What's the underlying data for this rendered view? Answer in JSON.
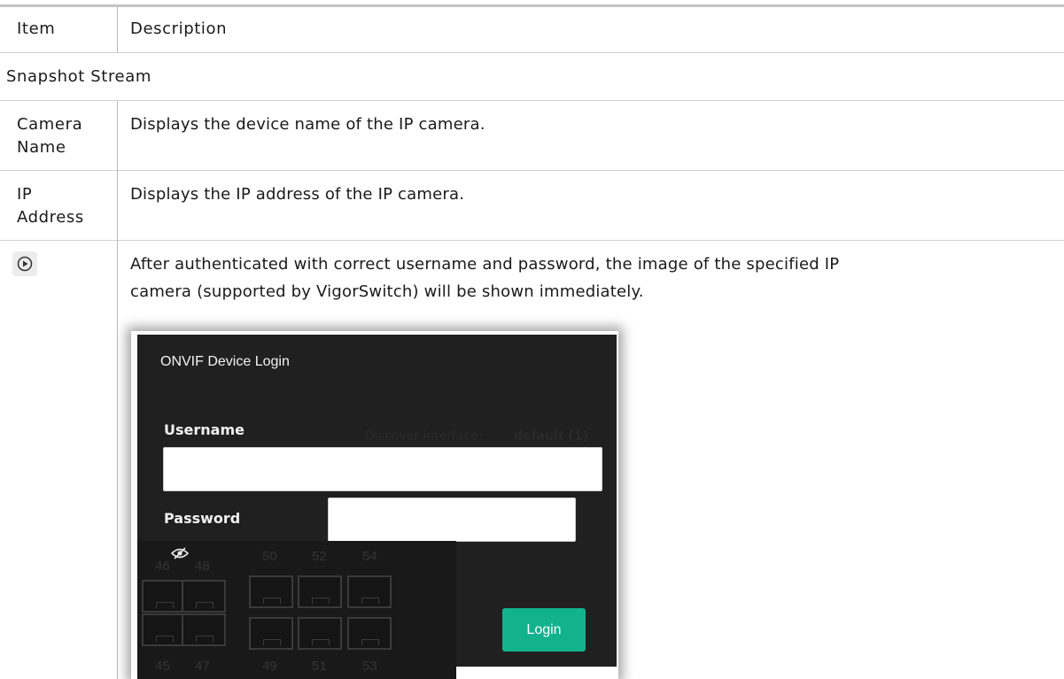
{
  "table": {
    "header": {
      "item": "Item",
      "description": "Description"
    },
    "section": "Snapshot Stream",
    "rows": [
      {
        "item_line1": "Camera",
        "item_line2": "Name",
        "description": "Displays the device name of the IP camera."
      },
      {
        "item_line1": "IP",
        "item_line2": "Address",
        "description": "Displays the IP address of the IP camera."
      },
      {
        "item_icon": "play-circle-icon",
        "description_line1": "After authenticated with correct username and password, the image of the specified IP",
        "description_line2": "camera (supported by VigorSwitch) will be shown immediately."
      }
    ]
  },
  "login_dialog": {
    "title": "ONVIF Device Login",
    "username_label": "Username",
    "username_value": "",
    "password_label": "Password",
    "password_value": "",
    "login_label": "Login",
    "background_text": {
      "discover_label": "Discover interface:",
      "discover_value": "default (1)"
    },
    "port_numbers_top": [
      "46",
      "48",
      "50",
      "52",
      "54"
    ],
    "port_numbers_bottom": [
      "45",
      "47",
      "49",
      "51",
      "53"
    ]
  },
  "colors": {
    "login_button": "#12b28d",
    "dialog_bg": "#202020"
  }
}
